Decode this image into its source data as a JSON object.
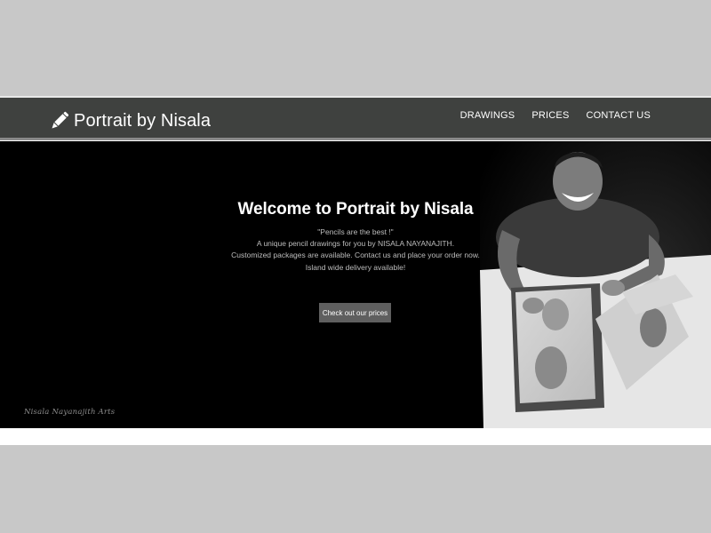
{
  "navbar": {
    "brand_icon": "pencil-icon",
    "brand_text": "Portrait by Nisala",
    "links": [
      "DRAWINGS",
      "PRICES",
      "CONTACT US"
    ]
  },
  "hero": {
    "title": "Welcome to Portrait by Nisala",
    "lines": [
      "\"Pencils are the best !\"",
      "A unique pencil drawings for you by NISALA NAYANAJITH.",
      "Customized packages are available. Contact us and place your order now.",
      "Island wide delivery available!"
    ],
    "cta_label": "Check out our prices",
    "signature": "Nisala Nayanajith Arts"
  },
  "colors": {
    "navbar_bg": "#3f413f",
    "hero_bg": "#000000",
    "button_bg": "#5f5f5f",
    "outer_bg": "#c8c8c8"
  }
}
